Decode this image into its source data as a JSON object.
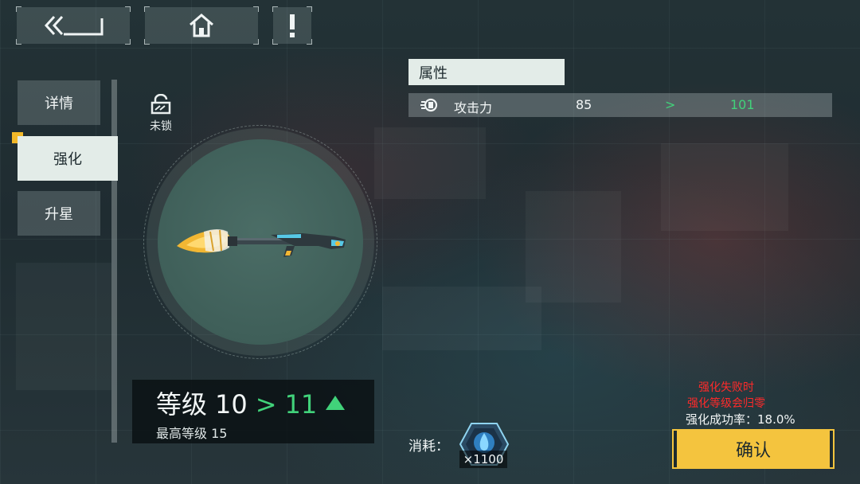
{
  "top_nav": {
    "back_icon": "double-chevron-back-icon",
    "home_icon": "home-icon",
    "alert_icon": "exclamation-icon"
  },
  "tabs": [
    {
      "label": "详情",
      "active": false
    },
    {
      "label": "强化",
      "active": true
    },
    {
      "label": "升星",
      "active": false
    }
  ],
  "lock": {
    "label": "未锁",
    "icon": "unlocked-icon"
  },
  "weapon": {
    "icon": "brush-rifle-weapon"
  },
  "level": {
    "label": "等级",
    "current": "10",
    "arrow": ">",
    "next": "11",
    "max_label": "最高等级 15"
  },
  "attributes": {
    "title": "属性",
    "rows": [
      {
        "icon": "fist-attack-icon",
        "name": "攻击力",
        "current": "85",
        "arrow": ">",
        "next": "101"
      }
    ]
  },
  "cost": {
    "label": "消耗：",
    "item_icon": "blue-crystal-icon",
    "quantity": "×1100"
  },
  "warning": {
    "line1": "强化失败时",
    "line2": "强化等级会归零"
  },
  "success_rate": {
    "label": "强化成功率：",
    "value": "18.0%"
  },
  "confirm_label": "确认",
  "colors": {
    "accent_green": "#41d27a",
    "confirm_yellow": "#f4c43e",
    "warning_red": "#ff2a2a",
    "tab_marker": "#f2b828"
  }
}
